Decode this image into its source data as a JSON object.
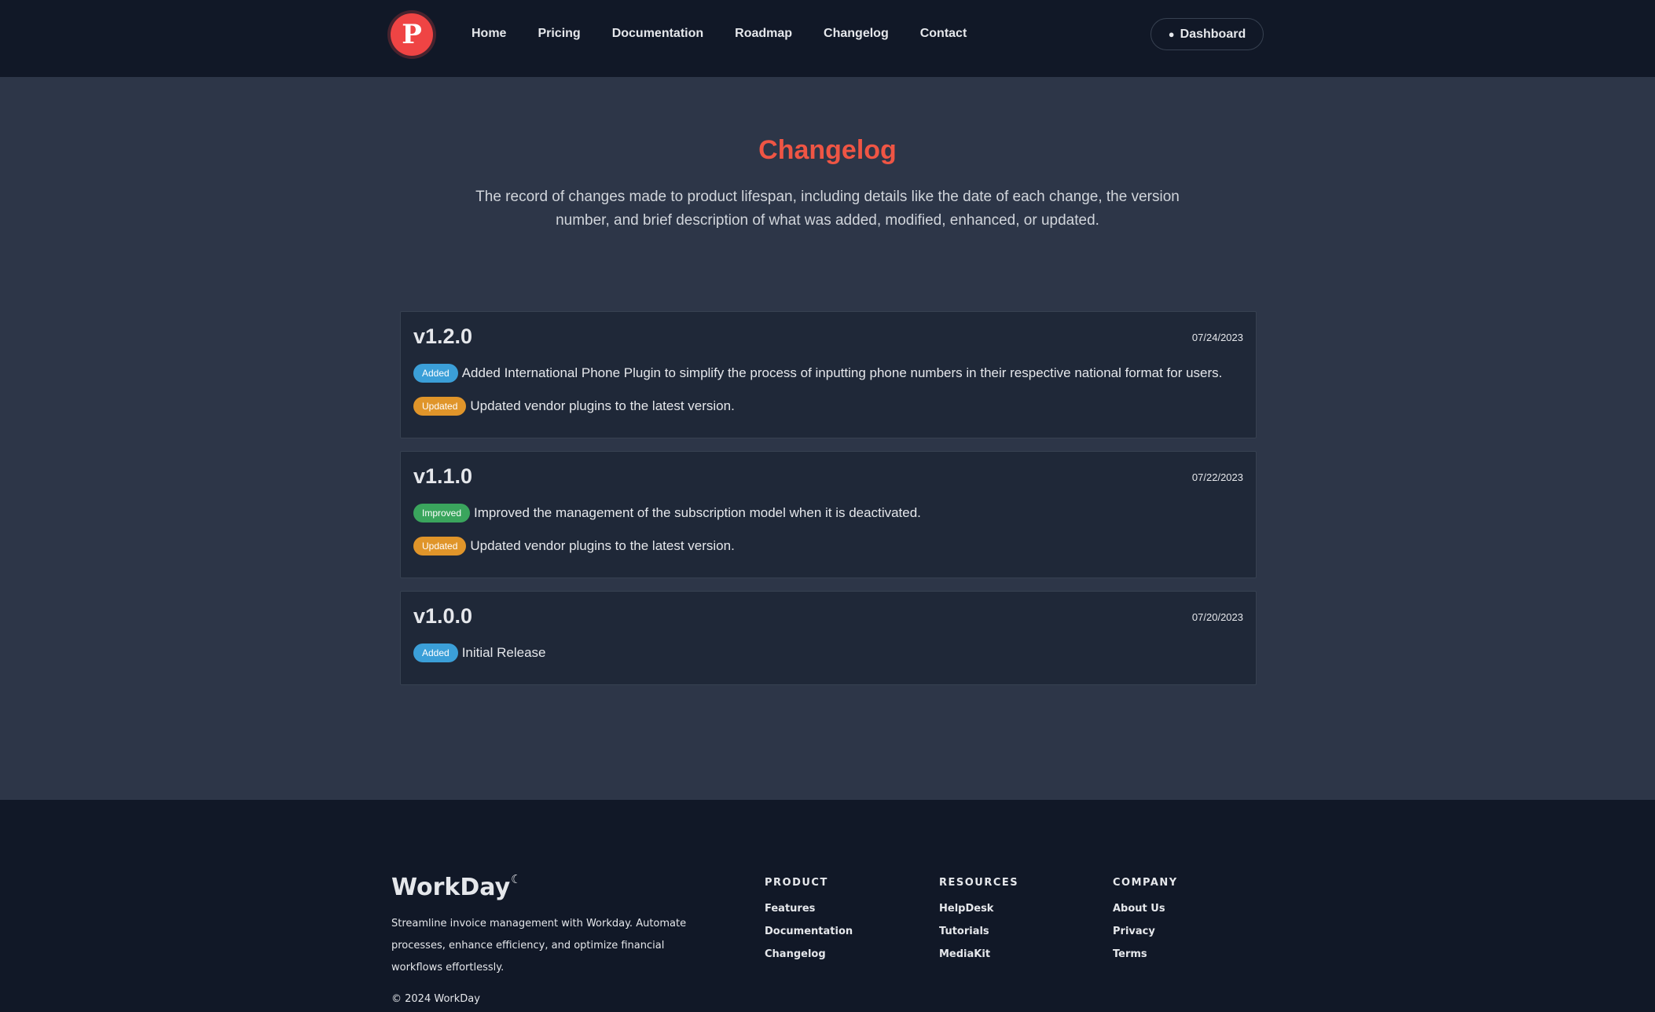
{
  "nav": {
    "logo_letter": "P",
    "links": [
      "Home",
      "Pricing",
      "Documentation",
      "Roadmap",
      "Changelog",
      "Contact"
    ],
    "dashboard_label": "Dashboard"
  },
  "hero": {
    "title": "Changelog",
    "description": "The record of changes made to product lifespan, including details like the date of each change, the version number, and brief description of what was added, modified, enhanced, or updated."
  },
  "releases": [
    {
      "version": "v1.2.0",
      "date": "07/24/2023",
      "entries": [
        {
          "type": "Added",
          "text": "Added International Phone Plugin to simplify the process of inputting phone numbers in their respective national format for users."
        },
        {
          "type": "Updated",
          "text": "Updated vendor plugins to the latest version."
        }
      ]
    },
    {
      "version": "v1.1.0",
      "date": "07/22/2023",
      "entries": [
        {
          "type": "Improved",
          "text": "Improved the management of the subscription model when it is deactivated."
        },
        {
          "type": "Updated",
          "text": "Updated vendor plugins to the latest version."
        }
      ]
    },
    {
      "version": "v1.0.0",
      "date": "07/20/2023",
      "entries": [
        {
          "type": "Added",
          "text": "Initial Release"
        }
      ]
    }
  ],
  "footer": {
    "brand": "WorkDay",
    "description": "Streamline invoice management with Workday. Automate processes, enhance efficiency, and optimize financial workflows effortlessly.",
    "copyright": "© 2024 WorkDay",
    "columns": [
      {
        "title": "PRODUCT",
        "links": [
          "Features",
          "Documentation",
          "Changelog"
        ]
      },
      {
        "title": "RESOURCES",
        "links": [
          "HelpDesk",
          "Tutorials",
          "MediaKit"
        ]
      },
      {
        "title": "COMPANY",
        "links": [
          "About Us",
          "Privacy",
          "Terms"
        ]
      }
    ]
  },
  "colors": {
    "accent": "#ef5544",
    "added": "#3b9fd8",
    "updated": "#e0952a",
    "improved": "#3aa55d"
  }
}
